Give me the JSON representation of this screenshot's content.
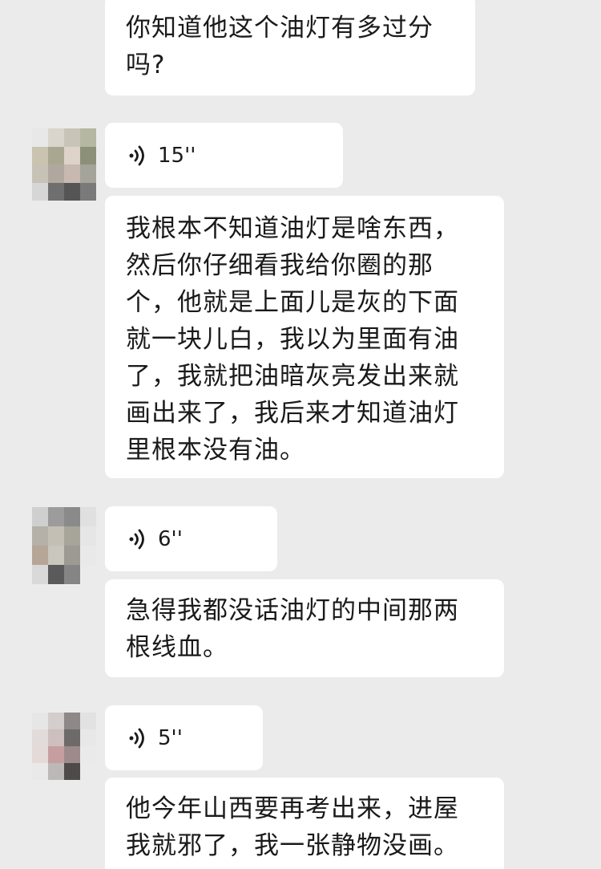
{
  "messages": [
    {
      "type": "text",
      "text": "你知道他这个油灯有多过分\n吗?"
    },
    {
      "type": "voice",
      "duration": "15''"
    },
    {
      "type": "text",
      "text": "我根本不知道油灯是啥东西，\n然后你仔细看我给你圈的那\n个，他就是上面儿是灰的下面\n就一块儿白，我以为里面有油\n了，我就把油暗灰亮发出来就\n画出来了，我后来才知道油灯\n里根本没有油。"
    },
    {
      "type": "voice",
      "duration": "6''"
    },
    {
      "type": "text",
      "text": "急得我都没话油灯的中间那两\n根线血。"
    },
    {
      "type": "voice",
      "duration": "5''"
    },
    {
      "type": "text",
      "text": "他今年山西要再考出来，进屋\n我就邪了，我一张静物没画。"
    }
  ],
  "icons": {
    "voice": "voice-wave-icon",
    "avatar": "pixelated-avatar"
  },
  "colors": {
    "background": "#ebebeb",
    "bubble": "#ffffff",
    "text": "#1a1a1a"
  }
}
